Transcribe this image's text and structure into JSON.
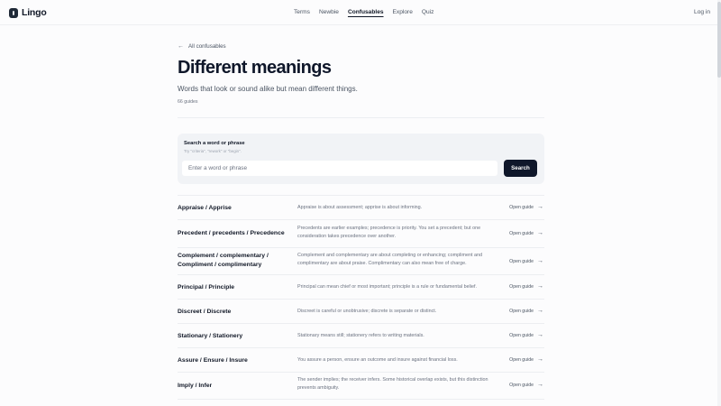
{
  "header": {
    "brand": "Lingo",
    "nav": [
      "Terms",
      "Newbie",
      "Confusables",
      "Explore",
      "Quiz"
    ],
    "active_nav": "Confusables",
    "login": "Log in"
  },
  "page": {
    "back_label": "All confusables",
    "title": "Different meanings",
    "subtitle": "Words that look or sound alike but mean different things.",
    "count": "66 guides"
  },
  "search": {
    "title": "Search a word or phrase",
    "hint": "Try \"criteria\", \"rework\" or \"begin\".",
    "placeholder": "Enter a word or phrase",
    "value": "",
    "button": "Search"
  },
  "open_label": "Open guide",
  "guides": [
    {
      "term": "Appraise / Apprise",
      "desc": "Appraise is about assessment; apprise is about informing."
    },
    {
      "term": "Precedent / precedents / Precedence",
      "desc": "Precedents are earlier examples; precedence is priority. You set a precedent; but one consideration takes precedence over another."
    },
    {
      "term": "Complement / complementary / Compliment / complimentary",
      "desc": "Complement and complementary are about completing or enhancing; compliment and complimentary are about praise. Complimentary can also mean free of charge."
    },
    {
      "term": "Principal / Principle",
      "desc": "Principal can mean chief or most important; principle is a rule or fundamental belief."
    },
    {
      "term": "Discreet / Discrete",
      "desc": "Discreet is careful or unobtrusive; discrete is separate or distinct."
    },
    {
      "term": "Stationary / Stationery",
      "desc": "Stationary means still; stationery refers to writing materials."
    },
    {
      "term": "Assure / Ensure / Insure",
      "desc": "You assure a person, ensure an outcome and insure against financial loss."
    },
    {
      "term": "Imply / Infer",
      "desc": "The sender implies; the receiver infers. Some historical overlap exists, but this distinction prevents ambiguity."
    }
  ]
}
